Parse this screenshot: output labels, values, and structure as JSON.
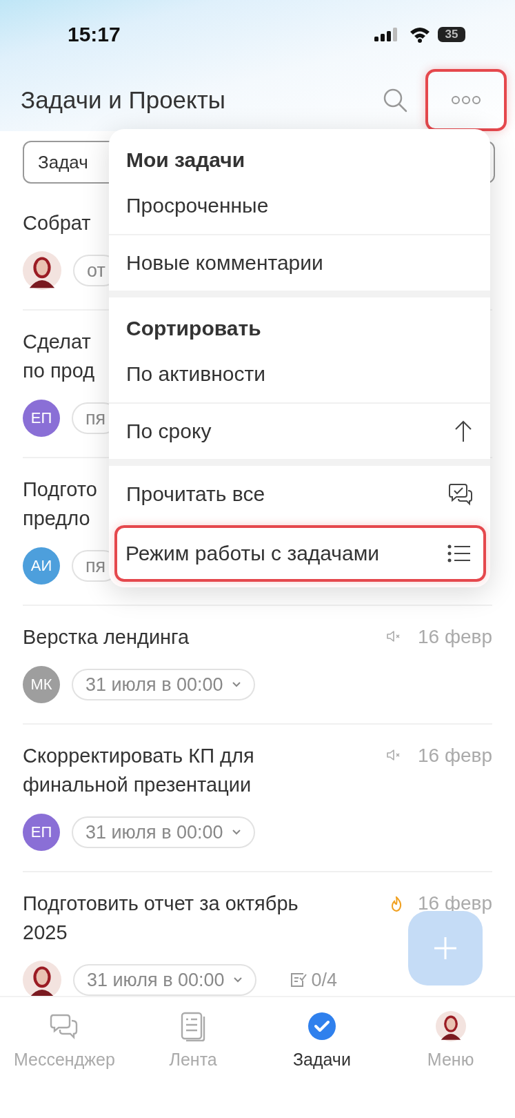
{
  "status_bar": {
    "time": "15:17",
    "battery": "35"
  },
  "header": {
    "title": "Задачи и Проекты",
    "more_highlighted": true
  },
  "filters": [
    {
      "label": "Задач"
    }
  ],
  "tasks": [
    {
      "title": "Собрат",
      "avatar": {
        "kind": "photo"
      },
      "deadline": "от",
      "dropdown": false
    },
    {
      "title": "Сделат\nпо прод",
      "avatar": {
        "kind": "initials",
        "initials": "ЕП",
        "color": "#8a6fd6"
      },
      "deadline": "пя",
      "dropdown": false
    },
    {
      "title": "Подгото\nпредло",
      "avatar": {
        "kind": "initials",
        "initials": "АИ",
        "color": "#4d9fdc"
      },
      "deadline": "пя",
      "dropdown": false
    },
    {
      "title": "Верстка лендинга",
      "muted": true,
      "date": "16 февр",
      "avatar": {
        "kind": "initials",
        "initials": "МК",
        "color": "#9e9e9e"
      },
      "deadline": "31 июля в 00:00",
      "dropdown": true
    },
    {
      "title": "Скорректировать КП для\nфинальной презентации",
      "muted": true,
      "date": "16 февр",
      "avatar": {
        "kind": "initials",
        "initials": "ЕП",
        "color": "#8a6fd6"
      },
      "deadline": "31 июля в 00:00",
      "dropdown": true
    },
    {
      "title": "Подготовить отчет за октябрь\n2025",
      "hot": true,
      "date": "16 февр",
      "avatar": {
        "kind": "photo"
      },
      "deadline": "31 июля в 00:00",
      "dropdown": true,
      "checklist": "0/4"
    }
  ],
  "menu": {
    "sections": [
      {
        "title": "Мои задачи",
        "items": [
          {
            "label": "Просроченные",
            "kind": "plain",
            "highlighted": false
          },
          {
            "label": "Новые комментарии",
            "kind": "plain",
            "highlighted": false
          }
        ]
      },
      {
        "title": "Сортировать",
        "items": [
          {
            "label": "По активности",
            "kind": "plain",
            "highlighted": false
          },
          {
            "label": "По сроку",
            "kind": "sort",
            "highlighted": false
          }
        ]
      },
      {
        "items": [
          {
            "label": "Прочитать все",
            "kind": "readall",
            "highlighted": false
          },
          {
            "label": "Режим работы с задачами",
            "kind": "mode",
            "highlighted": true
          }
        ]
      }
    ]
  },
  "tab_bar": [
    {
      "label": "Мессенджер",
      "kind": "chat",
      "selected": false
    },
    {
      "label": "Лента",
      "kind": "feed",
      "selected": false
    },
    {
      "label": "Задачи",
      "kind": "tasks",
      "selected": true
    },
    {
      "label": "Меню",
      "kind": "profile",
      "selected": false
    }
  ]
}
